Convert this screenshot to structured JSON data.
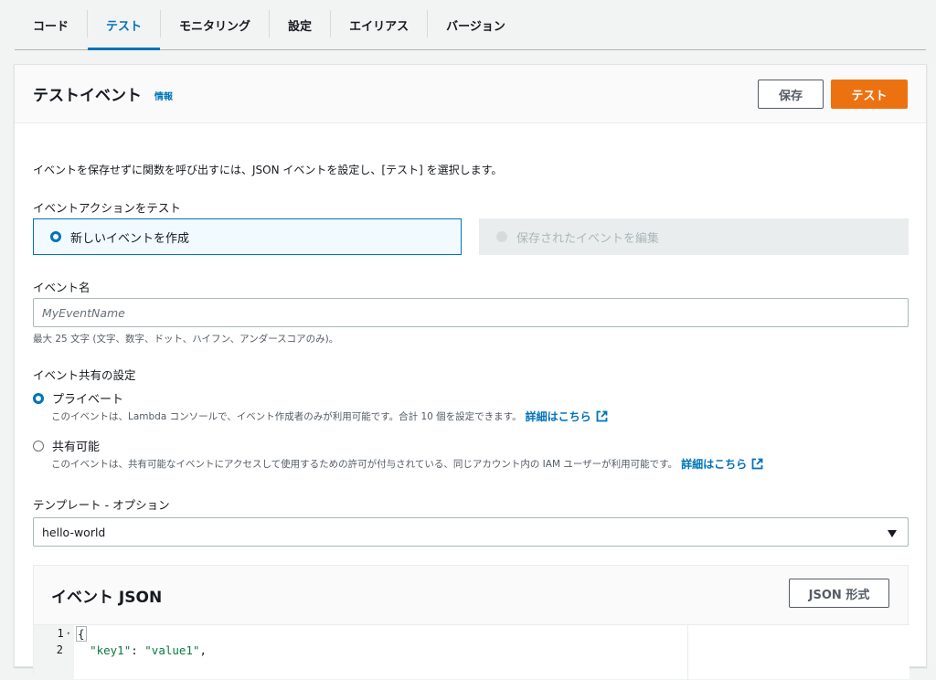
{
  "tabs": [
    {
      "label": "コード",
      "active": false
    },
    {
      "label": "テスト",
      "active": true
    },
    {
      "label": "モニタリング",
      "active": false
    },
    {
      "label": "設定",
      "active": false
    },
    {
      "label": "エイリアス",
      "active": false
    },
    {
      "label": "バージョン",
      "active": false
    }
  ],
  "panel": {
    "title": "テストイベント",
    "info_link": "情報",
    "save_label": "保存",
    "test_label": "テスト"
  },
  "description": "イベントを保存せずに関数を呼び出すには、JSON イベントを設定し、[テスト] を選択します。",
  "test_action": {
    "label": "イベントアクションをテスト",
    "option_new": "新しいイベントを作成",
    "option_edit": "保存されたイベントを編集",
    "selected": "new"
  },
  "event_name": {
    "label": "イベント名",
    "placeholder": "MyEventName",
    "hint": "最大 25 文字 (文字、数字、ドット、ハイフン、アンダースコアのみ)。"
  },
  "sharing": {
    "label": "イベント共有の設定",
    "private_label": "プライベート",
    "private_desc": "このイベントは、Lambda コンソールで、イベント作成者のみが利用可能です。合計 10 個を設定できます。",
    "shareable_label": "共有可能",
    "shareable_desc": "このイベントは、共有可能なイベントにアクセスして使用するための許可が付与されている、同じアカウント内の IAM ユーザーが利用可能です。",
    "learn_more": "詳細はこちら",
    "selected": "private"
  },
  "template": {
    "label": "テンプレート - オプション",
    "value": "hello-world"
  },
  "event_json": {
    "title": "イベント JSON",
    "format_button": "JSON 形式",
    "lines": [
      {
        "num": "1",
        "text": "{"
      },
      {
        "num": "2",
        "key": "\"key1\"",
        "value": "\"value1\""
      }
    ]
  },
  "colors": {
    "accent": "#0073bb",
    "primary_button": "#ec7211",
    "json_string": "#0b7a3e"
  }
}
